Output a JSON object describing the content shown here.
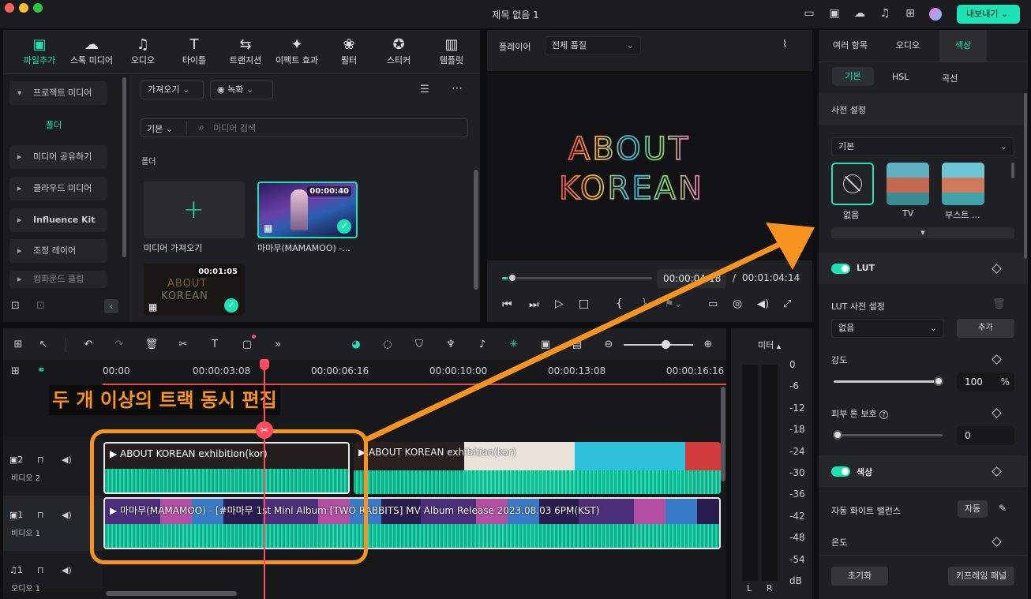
{
  "window": {
    "title": "제목 없음 1",
    "export_label": "내보내기"
  },
  "tabs": [
    {
      "label": "파일추가",
      "icon": "media-icon"
    },
    {
      "label": "스톡 미디어",
      "icon": "cloud-icon"
    },
    {
      "label": "오디오",
      "icon": "music-icon"
    },
    {
      "label": "타이틀",
      "icon": "title-icon"
    },
    {
      "label": "트랜지션",
      "icon": "transition-icon"
    },
    {
      "label": "이펙트 효과",
      "icon": "effects-icon"
    },
    {
      "label": "필터",
      "icon": "filter-icon"
    },
    {
      "label": "스티커",
      "icon": "sticker-icon"
    },
    {
      "label": "템플릿",
      "icon": "template-icon"
    }
  ],
  "sidebar": {
    "items": [
      {
        "label": "프로젝트 미디어"
      },
      {
        "label": "미디어 공유하기"
      },
      {
        "label": "클라우드 미디어"
      },
      {
        "label": "Influence Kit"
      },
      {
        "label": "조정 레이어"
      },
      {
        "label": "컴파운드 클립"
      }
    ],
    "selected_folder": "폴더"
  },
  "media": {
    "import_label": "가져오기",
    "record_label": "녹화",
    "sort_label": "기본",
    "search_placeholder": "미디어 검색",
    "folder_heading": "폴더",
    "add_media_label": "미디어 가져오기",
    "clip1": {
      "duration": "00:00:40",
      "name": "마마무(MAMAMOO) -..."
    },
    "clip2": {
      "duration": "00:01:05"
    }
  },
  "player": {
    "label": "플레이어",
    "quality": "전체 품질",
    "screen_text_1": "ABOUT",
    "screen_text_2": "KOREAN",
    "current_time": "00:00:04:18",
    "total_time": "00:01:04:14",
    "progress": 0.07
  },
  "right_panel": {
    "tabs": [
      "여러 항목",
      "오디오",
      "색상"
    ],
    "subtabs": [
      "기본",
      "HSL",
      "곡선"
    ],
    "preset_heading": "사전 설정",
    "preset_select": "기본",
    "presets": [
      {
        "label": "없음"
      },
      {
        "label": "TV"
      },
      {
        "label": "부스트 ..."
      }
    ],
    "lut_label": "LUT",
    "lut_preset_label": "LUT 사전 설정",
    "lut_value": "없음",
    "add_label": "추가",
    "intensity_label": "강도",
    "intensity_value": "100",
    "intensity_unit": "%",
    "skin_label": "피부 톤 보호",
    "skin_value": "0",
    "color_label": "색상",
    "awb_label": "자동 화이트 밸런스",
    "auto_label": "자동",
    "temp_label": "온도",
    "reset_label": "초기화",
    "keyframe_label": "키프레임 패널"
  },
  "timeline": {
    "ruler": [
      "00:00",
      "00:00:03:08",
      "00:00:06:16",
      "00:00:10:00",
      "00:00:13:08",
      "00:00:16:16"
    ],
    "caption": "두 개 이상의 트랙 동시 편집",
    "tracks": [
      {
        "id": "2",
        "name": "비디오 2"
      },
      {
        "id": "1",
        "name": "비디오 1"
      },
      {
        "id": "1",
        "name": "오디오 1"
      }
    ],
    "clips": [
      {
        "label": "ABOUT KOREAN exhibition(kor)"
      },
      {
        "label": "ABOUT KOREAN exhibition(kor)"
      },
      {
        "label": "마마무(MAMAMOO) - [#마마무 1st Mini Album [TWO RABBITS] MV Album Release 2023.08.03 6PM(KST)"
      }
    ]
  },
  "meter": {
    "label": "미터",
    "ticks": [
      "0",
      "-6",
      "-12",
      "-18",
      "-24",
      "-30",
      "-36",
      "-42",
      "-48",
      "-54",
      "dB"
    ],
    "left": "L",
    "right": "R"
  },
  "colors": {
    "accent": "#1ee3b4",
    "annotation": "#f7931e",
    "playhead": "#ff4d5e"
  }
}
